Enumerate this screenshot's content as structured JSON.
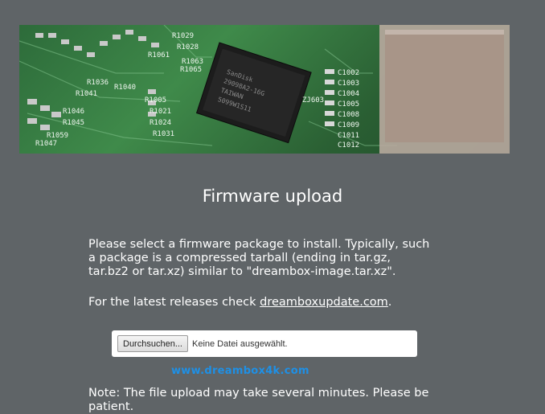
{
  "page": {
    "title": "Firmware upload",
    "intro": "Please select a firmware package to install. Typically, such a package is a compressed tarball (ending in tar.gz, tar.bz2 or tar.xz) similar to \"dreambox-image.tar.xz\".",
    "releases_prefix": "For the latest releases check ",
    "releases_link": "dreamboxupdate.com",
    "releases_suffix": ".",
    "note": "Note: The file upload may take several minutes. Please be patient."
  },
  "upload": {
    "browse_label": "Durchsuchen...",
    "status_text": "Keine Datei ausgewählt."
  },
  "watermark": "www.dreambox4k.com",
  "banner": {
    "chip_text": [
      "SanDisk",
      "29098A2-16G",
      "TAIWAN",
      "5099W1S11"
    ],
    "labels": [
      "R1036",
      "R1040",
      "R1041",
      "R1046",
      "R1045",
      "R1047",
      "R1059",
      "R1061",
      "R1065",
      "R1028",
      "R1029",
      "R1063",
      "R1005",
      "R1021",
      "R1024",
      "R1031",
      "C1002",
      "C1003",
      "C1004",
      "C1005",
      "C1008",
      "C1009",
      "C1011",
      "C1012",
      "ZJ603"
    ]
  },
  "colors": {
    "background": "#5f6467",
    "link_watermark": "#1e90e6",
    "pcb_green": "#2d6b3a"
  }
}
